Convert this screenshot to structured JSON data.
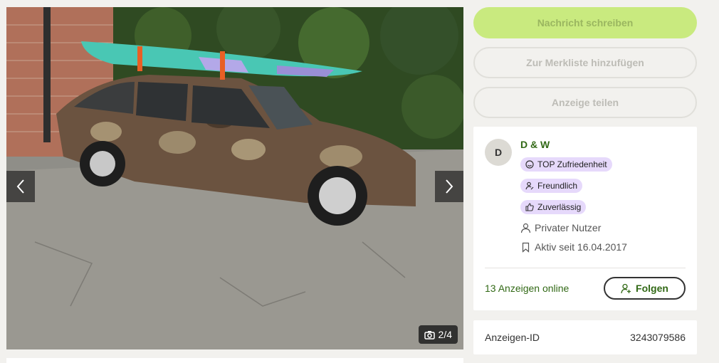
{
  "gallery": {
    "counter": "2/4",
    "icons": {
      "prev": "chevron-left-icon",
      "next": "chevron-right-icon",
      "camera": "camera-icon"
    }
  },
  "actions": {
    "message": "Nachricht schreiben",
    "watchlist": "Zur Merkliste hinzufügen",
    "share": "Anzeige teilen"
  },
  "seller": {
    "avatar_letter": "D",
    "name": "D & W",
    "badges": [
      "TOP Zufriedenheit",
      "Freundlich",
      "Zuverlässig"
    ],
    "type": "Privater Nutzer",
    "active_since": "Aktiv seit 16.04.2017",
    "ads_online": "13 Anzeigen online",
    "follow": "Folgen"
  },
  "listing": {
    "id_label": "Anzeigen-ID",
    "id_value": "3243079586"
  },
  "colors": {
    "accent_green": "#c9ea7f",
    "brand_green": "#326916",
    "badge_purple": "#e6d9fb"
  }
}
